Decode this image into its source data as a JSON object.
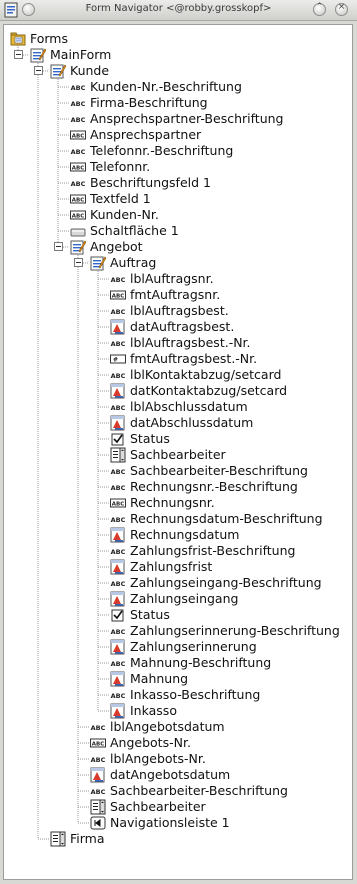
{
  "window": {
    "title": "Form Navigator <@robby.grosskopf>"
  },
  "titlebar_glyphs": {
    "minimize": "⌃",
    "close": "×"
  },
  "tree": [
    {
      "label": "Forms",
      "icon": "forms-folder-icon",
      "level": 0
    },
    {
      "label": "MainForm",
      "icon": "form-icon",
      "level": 1,
      "expanded": true
    },
    {
      "label": "Kunde",
      "icon": "form-icon",
      "level": 2,
      "expanded": true
    },
    {
      "label": "Kunden-Nr.-Beschriftung",
      "icon": "label-field-icon",
      "level": 3
    },
    {
      "label": "Firma-Beschriftung",
      "icon": "label-field-icon",
      "level": 3
    },
    {
      "label": "Ansprechspartner-Beschriftung",
      "icon": "label-field-icon",
      "level": 3
    },
    {
      "label": "Ansprechspartner",
      "icon": "text-box-icon",
      "level": 3
    },
    {
      "label": "Telefonnr.-Beschriftung",
      "icon": "label-field-icon",
      "level": 3
    },
    {
      "label": "Telefonnr.",
      "icon": "text-box-icon",
      "level": 3
    },
    {
      "label": "Beschriftungsfeld 1",
      "icon": "label-field-icon",
      "level": 3
    },
    {
      "label": "Textfeld 1",
      "icon": "text-box-icon",
      "level": 3
    },
    {
      "label": "Kunden-Nr.",
      "icon": "text-box-icon",
      "level": 3
    },
    {
      "label": "Schaltfläche 1",
      "icon": "push-button-icon",
      "level": 3
    },
    {
      "label": "Angebot",
      "icon": "form-icon",
      "level": 3,
      "expanded": true
    },
    {
      "label": "Auftrag",
      "icon": "form-icon",
      "level": 4,
      "expanded": true
    },
    {
      "label": "lblAuftragsnr.",
      "icon": "label-field-icon",
      "level": 5
    },
    {
      "label": "fmtAuftragsnr.",
      "icon": "text-box-icon",
      "level": 5
    },
    {
      "label": "lblAuftragsbest.",
      "icon": "label-field-icon",
      "level": 5
    },
    {
      "label": "datAuftragsbest.",
      "icon": "date-field-icon",
      "level": 5
    },
    {
      "label": "lblAuftragsbest.-Nr.",
      "icon": "label-field-icon",
      "level": 5
    },
    {
      "label": "fmtAuftragsbest.-Nr.",
      "icon": "formatted-field-icon",
      "level": 5
    },
    {
      "label": "lblKontaktabzug/setcard",
      "icon": "label-field-icon",
      "level": 5
    },
    {
      "label": "datKontaktabzug/setcard",
      "icon": "date-field-icon",
      "level": 5
    },
    {
      "label": "lblAbschlussdatum",
      "icon": "label-field-icon",
      "level": 5
    },
    {
      "label": "datAbschlussdatum",
      "icon": "date-field-icon",
      "level": 5
    },
    {
      "label": "Status",
      "icon": "checkbox-icon",
      "level": 5
    },
    {
      "label": "Sachbearbeiter",
      "icon": "list-box-icon",
      "level": 5
    },
    {
      "label": "Sachbearbeiter-Beschriftung",
      "icon": "label-field-icon",
      "level": 5
    },
    {
      "label": "Rechnungsnr.-Beschriftung",
      "icon": "label-field-icon",
      "level": 5
    },
    {
      "label": "Rechnungsnr.",
      "icon": "text-box-icon",
      "level": 5
    },
    {
      "label": "Rechnungsdatum-Beschriftung",
      "icon": "label-field-icon",
      "level": 5
    },
    {
      "label": "Rechnungsdatum",
      "icon": "date-field-icon",
      "level": 5
    },
    {
      "label": "Zahlungsfrist-Beschriftung",
      "icon": "label-field-icon",
      "level": 5
    },
    {
      "label": "Zahlungsfrist",
      "icon": "date-field-icon",
      "level": 5
    },
    {
      "label": "Zahlungseingang-Beschriftung",
      "icon": "label-field-icon",
      "level": 5
    },
    {
      "label": "Zahlungseingang",
      "icon": "date-field-icon",
      "level": 5
    },
    {
      "label": "Status",
      "icon": "checkbox-icon",
      "level": 5
    },
    {
      "label": "Zahlungserinnerung-Beschriftung",
      "icon": "label-field-icon",
      "level": 5
    },
    {
      "label": "Zahlungserinnerung",
      "icon": "date-field-icon",
      "level": 5
    },
    {
      "label": "Mahnung-Beschriftung",
      "icon": "label-field-icon",
      "level": 5
    },
    {
      "label": "Mahnung",
      "icon": "date-field-icon",
      "level": 5
    },
    {
      "label": "Inkasso-Beschriftung",
      "icon": "label-field-icon",
      "level": 5
    },
    {
      "label": "Inkasso",
      "icon": "date-field-icon",
      "level": 5
    },
    {
      "label": "lblAngebotsdatum",
      "icon": "label-field-icon",
      "level": 4
    },
    {
      "label": "Angebots-Nr.",
      "icon": "text-box-icon",
      "level": 4
    },
    {
      "label": "lblAngebots-Nr.",
      "icon": "label-field-icon",
      "level": 4
    },
    {
      "label": "datAngebotsdatum",
      "icon": "date-field-icon",
      "level": 4
    },
    {
      "label": "Sachbearbeiter-Beschriftung",
      "icon": "label-field-icon",
      "level": 4
    },
    {
      "label": "Sachbearbeiter",
      "icon": "list-box-icon",
      "level": 4
    },
    {
      "label": "Navigationsleiste 1",
      "icon": "navigation-bar-icon",
      "level": 4
    },
    {
      "label": "Firma",
      "icon": "list-box-icon",
      "level": 2
    }
  ],
  "icon_text": {
    "label_field": "ABC",
    "formatted_field": "#_"
  },
  "colors": {
    "folder": "#e3b73a",
    "form_pencil": "#f0a020",
    "form_blue": "#3466c9",
    "date_red": "#d93a2a",
    "tree_line": "#9a9a9a"
  }
}
